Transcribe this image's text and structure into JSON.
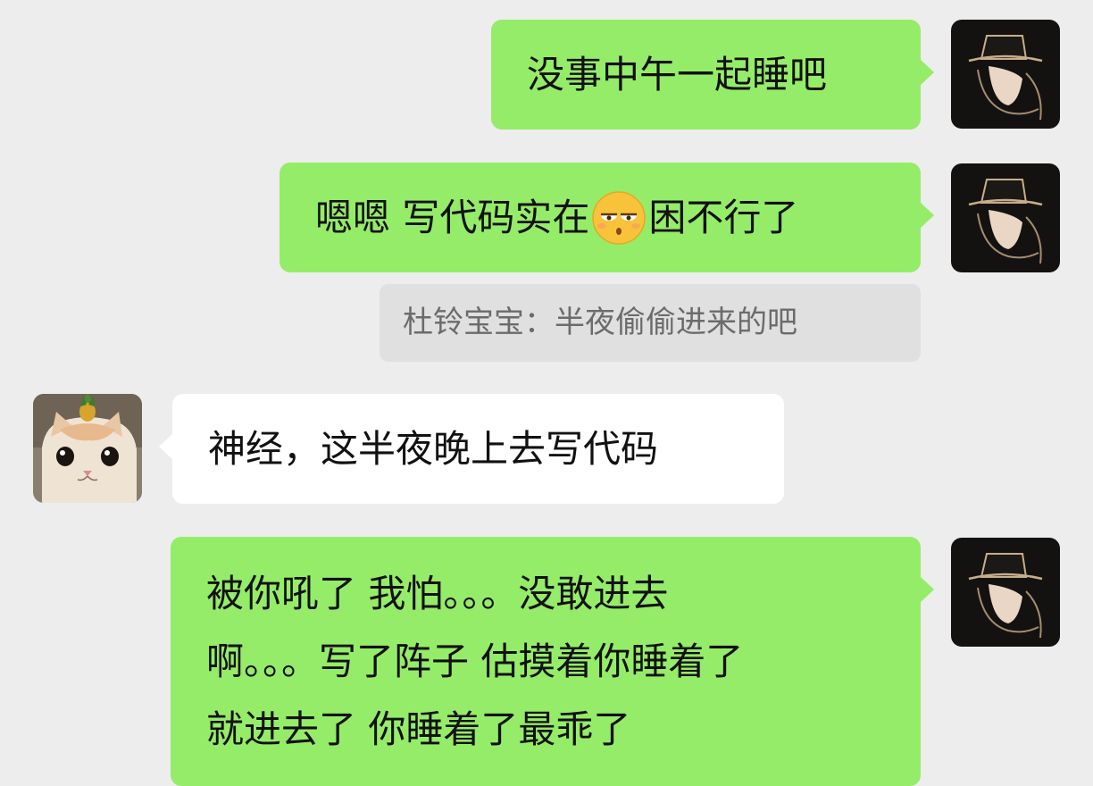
{
  "messages": [
    {
      "id": "m1",
      "side": "right",
      "text": "没事中午一起睡吧"
    },
    {
      "id": "m2",
      "side": "right",
      "text_before": "嗯嗯 写代码实在",
      "emoji": "sleepy-eyes-emoji",
      "text_after": "困不行了"
    },
    {
      "id": "m3",
      "type": "quote",
      "text": "杜铃宝宝：半夜偷偷进来的吧"
    },
    {
      "id": "m4",
      "side": "left",
      "text": "神经，这半夜晚上去写代码"
    },
    {
      "id": "m5",
      "side": "right",
      "lines": [
        "被你吼了 我怕。。。没敢进去",
        "啊。。。写了阵子 估摸着你睡着了",
        "就进去了 你睡着了最乖了"
      ]
    }
  ],
  "avatars": {
    "self": "top-hat-man-avatar",
    "other": "cat-with-pineapple-avatar"
  },
  "colors": {
    "background": "#ededed",
    "self_bubble": "#95ec69",
    "other_bubble": "#ffffff",
    "quote_bubble": "#e0e0e0"
  }
}
